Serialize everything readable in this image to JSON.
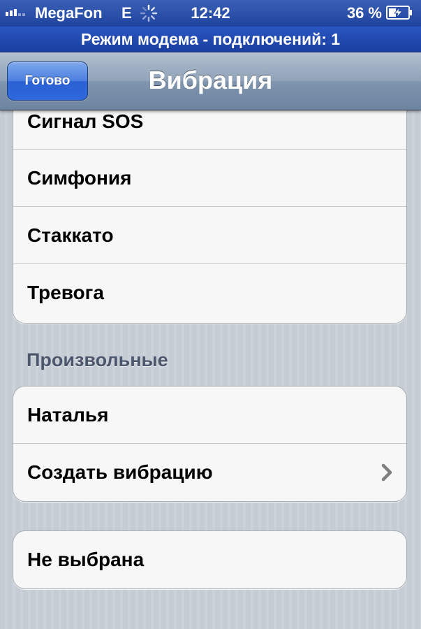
{
  "status_bar": {
    "carrier": "MegaFon",
    "network": "E",
    "time": "12:42",
    "battery_percent": "36 %"
  },
  "tether_banner": {
    "text": "Режим модема - подключений: 1"
  },
  "nav_bar": {
    "done_label": "Готово",
    "title": "Вибрация"
  },
  "standard_group": {
    "items": [
      {
        "label": "Сигнал SOS"
      },
      {
        "label": "Симфония"
      },
      {
        "label": "Стаккато"
      },
      {
        "label": "Тревога"
      }
    ]
  },
  "custom_section": {
    "header": "Произвольные",
    "items": [
      {
        "label": "Наталья"
      },
      {
        "label": "Создать вибрацию"
      }
    ]
  },
  "none_group": {
    "items": [
      {
        "label": "Не выбрана"
      }
    ]
  },
  "colors": {
    "status_bar": "#1f44a0",
    "tether_banner": "#2a56c2",
    "done_button": "#2a61d3",
    "section_header": "#4c566c"
  },
  "icons": {
    "chevron": "chevron-right-icon",
    "activity": "activity-spinner-icon",
    "battery": "battery-charging-icon",
    "signal": "signal-bars-icon"
  }
}
